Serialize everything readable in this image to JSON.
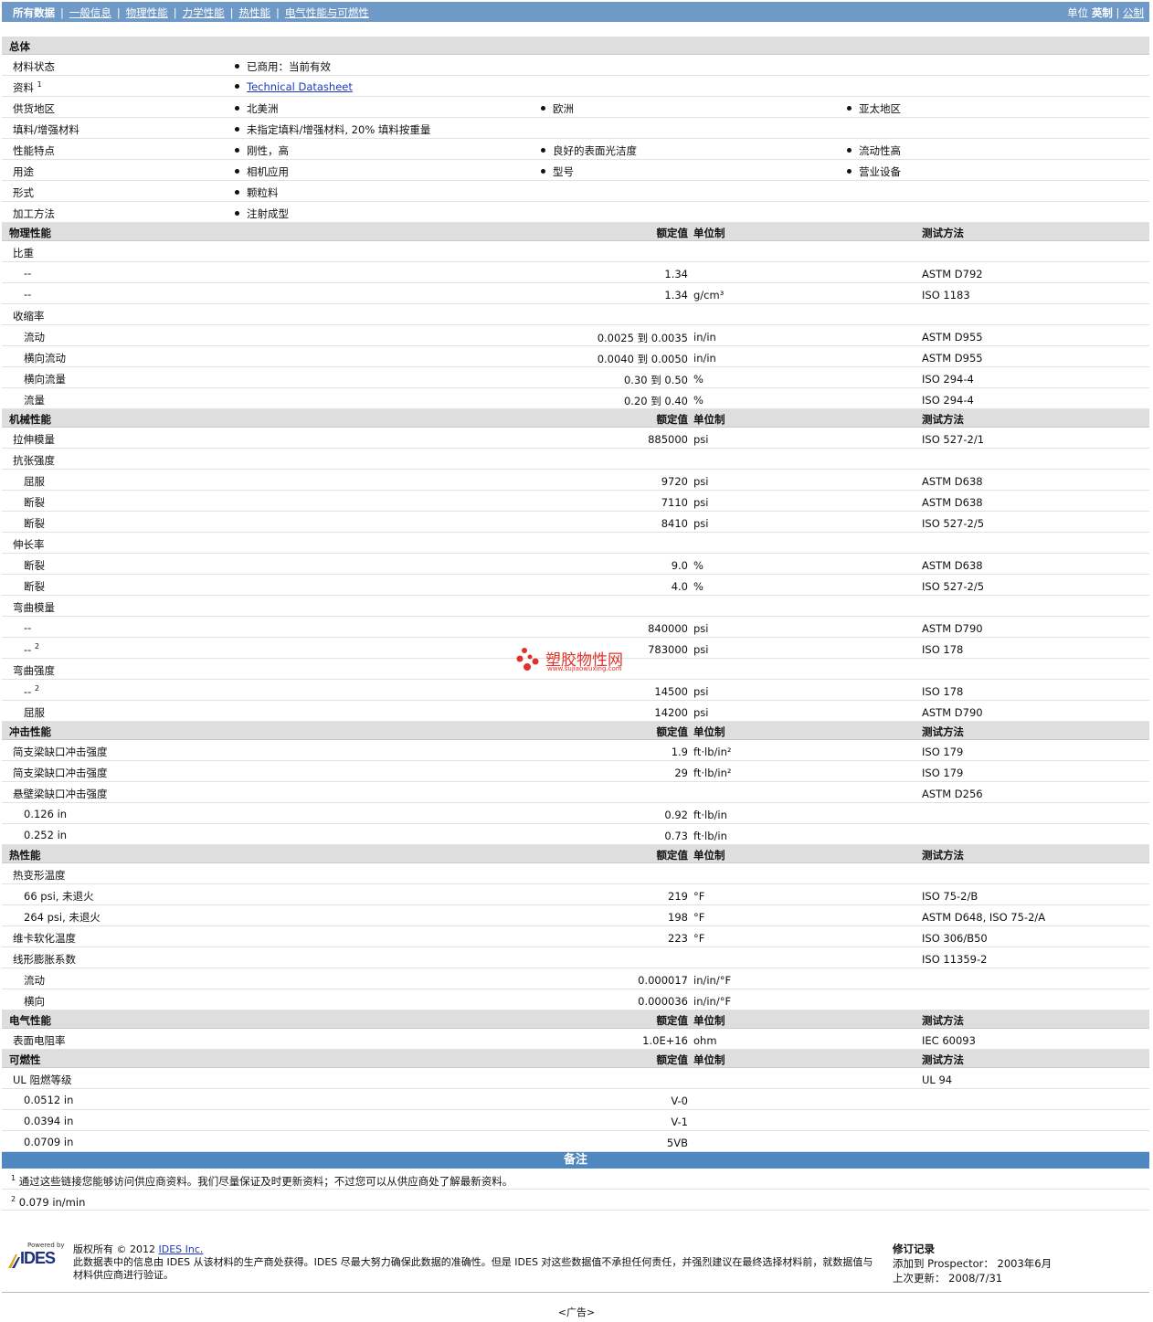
{
  "nav": {
    "tabs": [
      "所有数据",
      "一般信息",
      "物理性能",
      "力学性能",
      "热性能",
      "电气性能与可燃性"
    ],
    "units_label": "单位",
    "unit_active": "英制",
    "unit_other": "公制",
    "unit_sep": "|"
  },
  "general": {
    "title": "总体",
    "rows": [
      {
        "label": "材料状态",
        "items": [
          "已商用：当前有效"
        ]
      },
      {
        "label": "资料",
        "sup": "1",
        "items": [
          "Technical Datasheet"
        ],
        "link": true
      },
      {
        "label": "供货地区",
        "items": [
          "北美洲",
          "欧洲",
          "亚太地区"
        ]
      },
      {
        "label": "填料/增强材料",
        "items": [
          "未指定填料/增强材料, 20% 填料按重量"
        ]
      },
      {
        "label": "性能特点",
        "items": [
          "刚性，高",
          "良好的表面光洁度",
          "流动性高"
        ]
      },
      {
        "label": "用途",
        "items": [
          "相机应用",
          "型号",
          "营业设备"
        ]
      },
      {
        "label": "形式",
        "items": [
          "颗粒料"
        ]
      },
      {
        "label": "加工方法",
        "items": [
          "注射成型"
        ]
      }
    ]
  },
  "col_headers": {
    "value": "额定值",
    "unit": "单位制",
    "method": "测试方法"
  },
  "sections": [
    {
      "title": "物理性能",
      "rows": [
        {
          "label": "比重"
        },
        {
          "label": "--",
          "sub": true,
          "value": "1.34",
          "method": "ASTM D792"
        },
        {
          "label": "--",
          "sub": true,
          "value": "1.34",
          "unit": "g/cm³",
          "method": "ISO 1183"
        },
        {
          "label": "收缩率"
        },
        {
          "label": "流动",
          "sub": true,
          "value": "0.0025 到  0.0035",
          "unit": "in/in",
          "method": "ASTM D955"
        },
        {
          "label": "横向流动",
          "sub": true,
          "value": "0.0040 到  0.0050",
          "unit": "in/in",
          "method": "ASTM D955"
        },
        {
          "label": "横向流量",
          "sub": true,
          "value": "0.30 到  0.50",
          "unit": "%",
          "method": "ISO 294-4"
        },
        {
          "label": "流量",
          "sub": true,
          "value": "0.20 到  0.40",
          "unit": "%",
          "method": "ISO 294-4"
        }
      ]
    },
    {
      "title": "机械性能",
      "rows": [
        {
          "label": "拉伸模量",
          "value": "885000",
          "unit": "psi",
          "method": "ISO 527-2/1"
        },
        {
          "label": "抗张强度"
        },
        {
          "label": "屈服",
          "sub": true,
          "value": "9720",
          "unit": "psi",
          "method": "ASTM D638"
        },
        {
          "label": "断裂",
          "sub": true,
          "value": "7110",
          "unit": "psi",
          "method": "ASTM D638"
        },
        {
          "label": "断裂",
          "sub": true,
          "value": "8410",
          "unit": "psi",
          "method": "ISO 527-2/5"
        },
        {
          "label": "伸长率"
        },
        {
          "label": "断裂",
          "sub": true,
          "value": "9.0",
          "unit": "%",
          "method": "ASTM D638"
        },
        {
          "label": "断裂",
          "sub": true,
          "value": "4.0",
          "unit": "%",
          "method": "ISO 527-2/5"
        },
        {
          "label": "弯曲模量"
        },
        {
          "label": "--",
          "sub": true,
          "value": "840000",
          "unit": "psi",
          "method": "ASTM D790"
        },
        {
          "label": "--",
          "sup": "2",
          "sub": true,
          "value": "783000",
          "unit": "psi",
          "method": "ISO 178"
        },
        {
          "label": "弯曲强度"
        },
        {
          "label": "--",
          "sup": "2",
          "sub": true,
          "value": "14500",
          "unit": "psi",
          "method": "ISO 178"
        },
        {
          "label": "屈服",
          "sub": true,
          "value": "14200",
          "unit": "psi",
          "method": "ASTM D790"
        }
      ]
    },
    {
      "title": "冲击性能",
      "rows": [
        {
          "label": "简支梁缺口冲击强度",
          "value": "1.9",
          "unit": "ft·lb/in²",
          "method": "ISO 179"
        },
        {
          "label": "简支梁缺口冲击强度",
          "value": "29",
          "unit": "ft·lb/in²",
          "method": "ISO 179"
        },
        {
          "label": "悬壁梁缺口冲击强度",
          "method": "ASTM D256"
        },
        {
          "label": "0.126 in",
          "sub": true,
          "value": "0.92",
          "unit": "ft·lb/in"
        },
        {
          "label": "0.252 in",
          "sub": true,
          "value": "0.73",
          "unit": "ft·lb/in"
        }
      ]
    },
    {
      "title": "热性能",
      "rows": [
        {
          "label": "热变形温度"
        },
        {
          "label": "66 psi, 未退火",
          "sub": true,
          "value": "219",
          "unit": "°F",
          "method": "ISO 75-2/B"
        },
        {
          "label": "264 psi, 未退火",
          "sub": true,
          "value": "198",
          "unit": "°F",
          "method": "ASTM D648, ISO 75-2/A"
        },
        {
          "label": "维卡软化温度",
          "value": "223",
          "unit": "°F",
          "method": "ISO 306/B50"
        },
        {
          "label": "线形膨胀系数",
          "method": "ISO 11359-2"
        },
        {
          "label": "流动",
          "sub": true,
          "value": "0.000017",
          "unit": "in/in/°F"
        },
        {
          "label": "横向",
          "sub": true,
          "value": "0.000036",
          "unit": "in/in/°F"
        }
      ]
    },
    {
      "title": "电气性能",
      "rows": [
        {
          "label": "表面电阻率",
          "value": "1.0E+16",
          "unit": "ohm",
          "method": "IEC 60093"
        }
      ]
    },
    {
      "title": "可燃性",
      "rows": [
        {
          "label": "UL 阻燃等级",
          "method": "UL 94"
        },
        {
          "label": "0.0512 in",
          "sub": true,
          "value": "V-0"
        },
        {
          "label": "0.0394 in",
          "sub": true,
          "value": "V-1"
        },
        {
          "label": "0.0709 in",
          "sub": true,
          "value": "5VB"
        }
      ]
    }
  ],
  "notes": {
    "title": "备注",
    "items": [
      {
        "num": "1",
        "text": "通过这些链接您能够访问供应商资料。我们尽量保证及时更新资料；不过您可以从供应商处了解最新资料。"
      },
      {
        "num": "2",
        "text": "0.079 in/min"
      }
    ]
  },
  "footer": {
    "powered_by": "Powered by",
    "logo_text": "IDES",
    "copyright_prefix": "版权所有  © 2012 ",
    "company_link": "IDES Inc.",
    "disclaimer": "此数据表中的信息由 IDES 从该材料的生产商处获得。IDES 尽最大努力确保此数据的准确性。但是 IDES 对这些数据值不承担任何责任，并强烈建议在最终选择材料前，就数据值与材料供应商进行验证。",
    "revision_title": "修订记录",
    "added_line": "添加到 Prospector：  2003年6月",
    "updated_line": "上次更新：  2008/7/31"
  },
  "watermark": {
    "cn": "塑胶物性网",
    "url": "www.sujiaowuxing.com",
    "color": "#e0322a"
  },
  "ad": "<广告>"
}
